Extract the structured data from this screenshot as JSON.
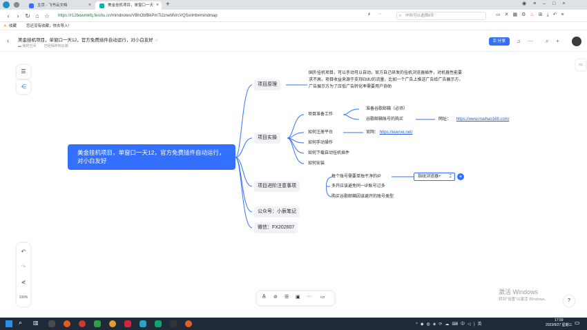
{
  "browser": {
    "tabs": [
      {
        "label": "主页 - 飞书云文档",
        "active": false
      },
      {
        "label": "美金挂机项目，单窗口一天12",
        "active": true
      }
    ],
    "url_prefix": "https://",
    "url_host": "r12bowmkfq.feishu.cn",
    "url_path": "/mindnotes/VBhObfBkPmTi2zneMVrcVQSxnHb#mindmap",
    "search_placeholder": "中秋可以选择8天",
    "bookmarks_label": "收藏",
    "bookmark_item": "您还没有收藏，快去导入!"
  },
  "header": {
    "title": "美金挂机项目，单窗口一天12，官方免费插件自动运行，对小白友好",
    "breadcrumb_space": "我的空间",
    "save_status": "已经保存到云端",
    "share_label": "分享"
  },
  "mindmap": {
    "root": "美金挂机项目，单窗口一天12，官方免费插件自动运行，对小白友好",
    "b1": {
      "label": "项目原理",
      "detail": "国外挂机项目，可以手动可以自动，官方自己研发的挂机浏览器插件，对机器性能要求不高，项目收益来源于支持EMU的流量，比如一个广告上推送广告给广告展示方，广告展示方为了压低广告转化率需要用户协助"
    },
    "b2": {
      "label": "项目实操",
      "c1": "项目准备工作",
      "c1a": "准备谷歌邮箱（必须）",
      "c1b": "谷歌邮箱账号的购买",
      "site_label": "网址：",
      "site_url": "https://www.maihao168.com/",
      "c2": "如何注册平台",
      "official_label": "官网：",
      "official_url": "https://everve.net/",
      "c3": "如何手动操作",
      "c4": "如何下载自动挂机插件",
      "c5": "如何安装"
    },
    "b3": {
      "label": "项目进阶注意事项",
      "c1": "每个账号需要单独干净的IP",
      "c1_child": "指纹浏览器+",
      "c2": "多开应该避免同一IP账号过多",
      "c3": "购买谷歌邮箱因该避开的账号类型"
    },
    "b4": {
      "label": "公众号：小辰笔记"
    },
    "b5": {
      "label": "微信：FX202607"
    }
  },
  "canvas": {
    "zoom": "100%",
    "watermark_title": "激活 Windows",
    "watermark_sub": "转到\"设置\"以激活 Windows。"
  },
  "taskbar": {
    "time": "17:59",
    "date": "2023/9/27 星期三"
  },
  "colors": {
    "accent": "#3370ff",
    "branch_line": "#3370ff",
    "taskbar": "#1f2b38"
  }
}
